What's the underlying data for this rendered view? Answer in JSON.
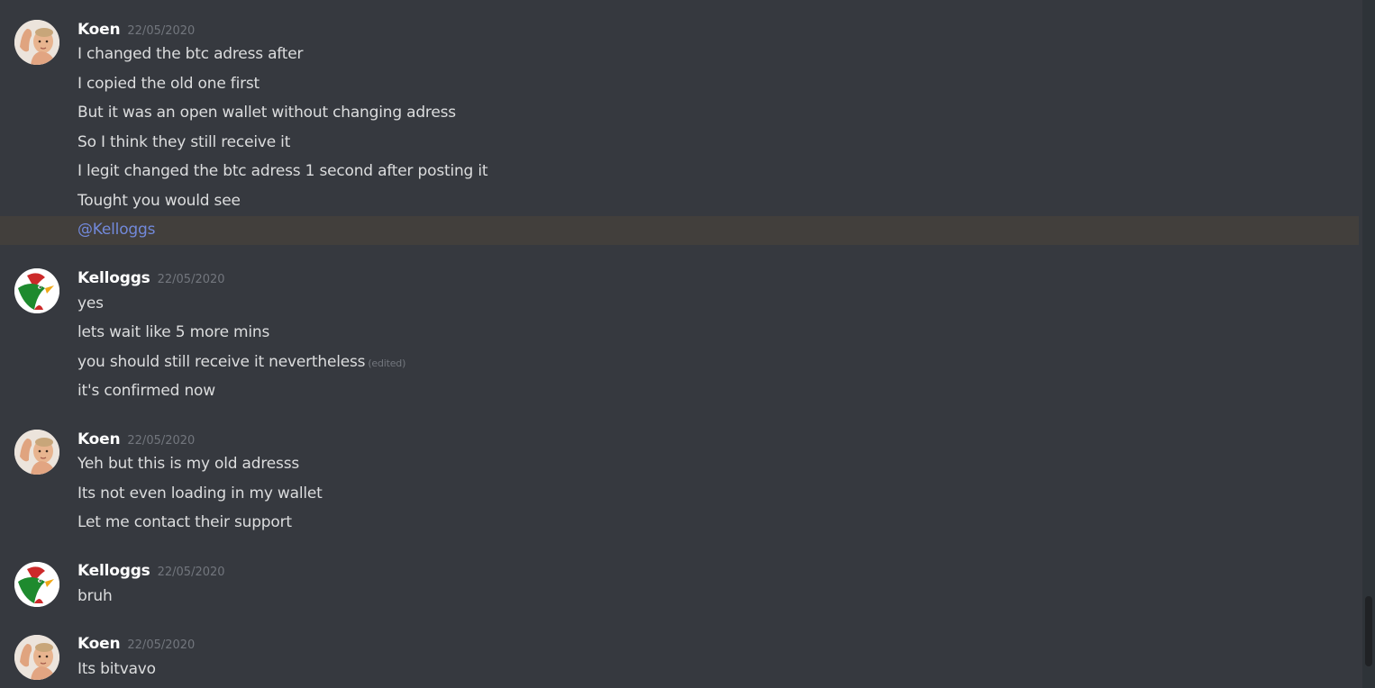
{
  "messages": [
    {
      "author": "Koen",
      "timestamp": "22/05/2020",
      "lines": [
        "I changed the btc adress after",
        "I copied the old one first",
        "But it was an open wallet without changing adress",
        "So I think they still receive it",
        "I legit changed the btc adress 1 second after posting it",
        "Tought you would see",
        "@Kelloggs"
      ]
    },
    {
      "author": "Kelloggs",
      "timestamp": "22/05/2020",
      "lines": [
        "yes",
        "lets wait like 5 more mins",
        "you should still receive it nevertheless",
        "it's confirmed now"
      ],
      "edited_label": "(edited)"
    },
    {
      "author": "Koen",
      "timestamp": "22/05/2020",
      "lines": [
        "Yeh but this is my old adresss",
        "Its not even loading in my wallet",
        "Let me contact their support"
      ]
    },
    {
      "author": "Kelloggs",
      "timestamp": "22/05/2020",
      "lines": [
        "bruh"
      ]
    },
    {
      "author": "Koen",
      "timestamp": "22/05/2020",
      "lines": [
        "Its bitvavo"
      ]
    }
  ],
  "icons": {
    "koen_avatar": "baby-flexing-avatar-icon",
    "kelloggs_avatar": "rooster-logo-avatar-icon"
  },
  "colors": {
    "background": "#36393f",
    "mention_highlight": "#423f3c",
    "mention_text": "#7289da",
    "username": "#ffffff",
    "message_text": "#dcddde",
    "timestamp": "#72767d"
  }
}
